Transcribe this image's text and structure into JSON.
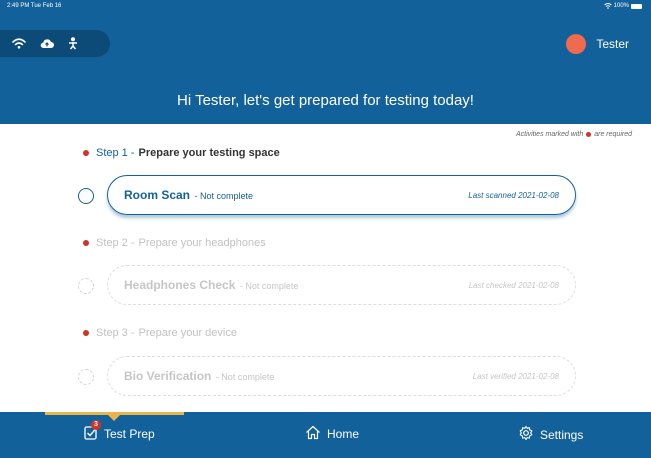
{
  "status_bar": {
    "time": "2:49 PM  Tue Feb 16",
    "battery": "100%"
  },
  "header": {
    "user_name": "Tester",
    "greeting": "Hi Tester, let's get prepared for testing today!"
  },
  "legend": {
    "before": "Activities marked with",
    "after": "are required"
  },
  "steps": [
    {
      "number": "Step 1 -",
      "title": "Prepare your testing space",
      "card_title": "Room Scan",
      "card_status": "- Not complete",
      "card_meta": "Last scanned 2021-02-08"
    },
    {
      "number": "Step 2 -",
      "title": "Prepare your headphones",
      "card_title": "Headphones Check",
      "card_status": "- Not complete",
      "card_meta": "Last checked 2021-02-08"
    },
    {
      "number": "Step 3 -",
      "title": "Prepare your device",
      "card_title": "Bio Verification",
      "card_status": "- Not complete",
      "card_meta": "Last verified 2021-02-08"
    }
  ],
  "nav": {
    "items": [
      {
        "label": "Test Prep",
        "icon": "checklist-icon",
        "badge": "3"
      },
      {
        "label": "Home",
        "icon": "home-icon"
      },
      {
        "label": "Settings",
        "icon": "gear-icon"
      }
    ]
  },
  "colors": {
    "primary": "#13619a",
    "accent": "#e9b54b",
    "required": "#d23328",
    "avatar": "#ef6a4f"
  }
}
